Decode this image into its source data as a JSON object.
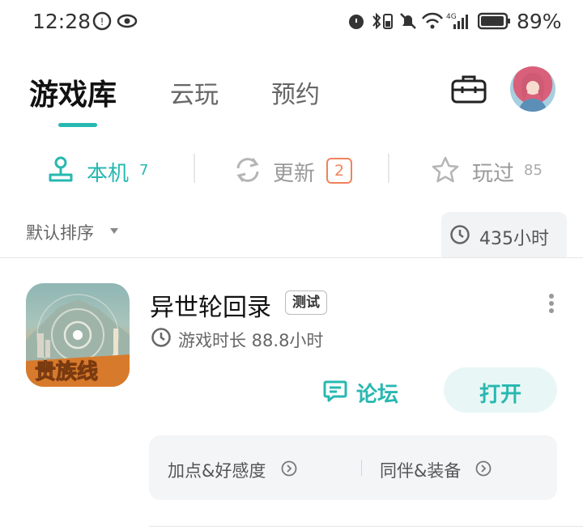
{
  "status_bar": {
    "time": "12:28",
    "battery": "89%"
  },
  "header": {
    "tabs": [
      {
        "label": "游戏库",
        "active": true
      },
      {
        "label": "云玩"
      },
      {
        "label": "预约"
      }
    ],
    "icons": [
      "toolbox-icon",
      "avatar"
    ]
  },
  "sub_tabs": [
    {
      "label": "本机",
      "count": "7",
      "icon": "local-device-icon",
      "active": true
    },
    {
      "label": "更新",
      "count": "2",
      "icon": "refresh-icon"
    },
    {
      "label": "玩过",
      "count": "85",
      "icon": "star-icon"
    }
  ],
  "sort": {
    "label": "默认排序",
    "total_hours": "435小时"
  },
  "game": {
    "name": "异世轮回录",
    "tag": "测试",
    "play_time": "游戏时长 88.8小时",
    "icon_text": "贵族线",
    "forum_label": "论坛",
    "open_label": "打开",
    "guides": [
      "加点&好感度",
      "同伴&装备"
    ]
  },
  "colors": {
    "accent": "#27b8b0",
    "update_badge": "#f0835b"
  }
}
